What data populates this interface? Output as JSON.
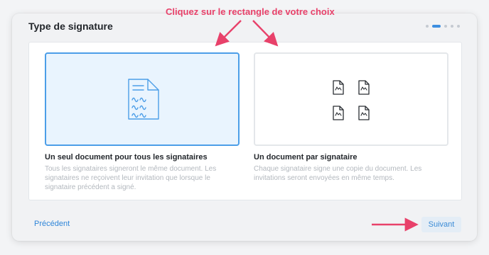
{
  "annotation": {
    "text": "Cliquez sur le rectangle de votre choix",
    "color": "#e8416a"
  },
  "dialog": {
    "title": "Type de signature",
    "steps": {
      "total": 5,
      "current": 2
    }
  },
  "options": [
    {
      "title": "Un seul document pour tous les signataires",
      "description": "Tous les signataires signeront le même document. Les signataires ne reçoivent leur invitation que lorsque le signataire précédent a signé.",
      "selected": true,
      "icon": "single-document-icon"
    },
    {
      "title": "Un document par signataire",
      "description": "Chaque signataire signe une copie du document. Les invitations seront envoyées en même temps.",
      "selected": false,
      "icon": "multiple-documents-icon"
    }
  ],
  "footer": {
    "previous_label": "Précédent",
    "next_label": "Suivant"
  },
  "colors": {
    "accent": "#4c9ee8",
    "selected_bg": "#e9f4fe",
    "annotation": "#e8416a"
  }
}
